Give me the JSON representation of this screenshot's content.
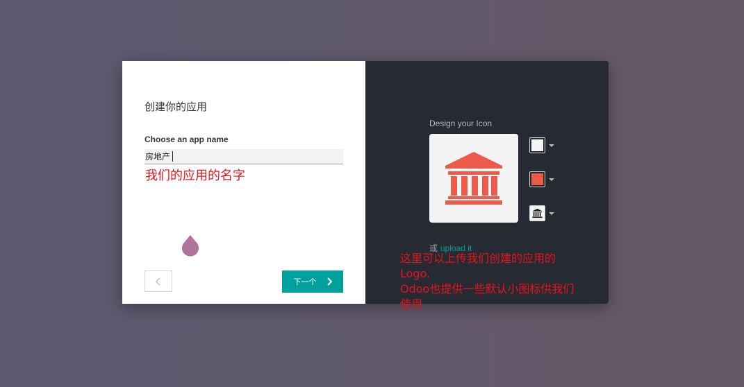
{
  "dialog": {
    "title": "创建你的应用",
    "app_name_label": "Choose an app name",
    "app_name_value": "房地产",
    "next_label": "下一个",
    "design_label": "Design your Icon",
    "upload_prefix": "或",
    "upload_link": "upload it",
    "icon_name": "bank-icon",
    "colors": {
      "accent": "#00a09d",
      "icon_color": "#ee5a4a",
      "background_color": "#f4f4f4",
      "panel_dark": "#262a33"
    }
  },
  "annotations": {
    "name_note": "我们的应用的名字",
    "logo_note": [
      "这里可以上传我们创建的应用的",
      "Logo.",
      "Odoo也提供一些默认小图标供我们",
      "使用"
    ],
    "color": "#e8141c"
  }
}
